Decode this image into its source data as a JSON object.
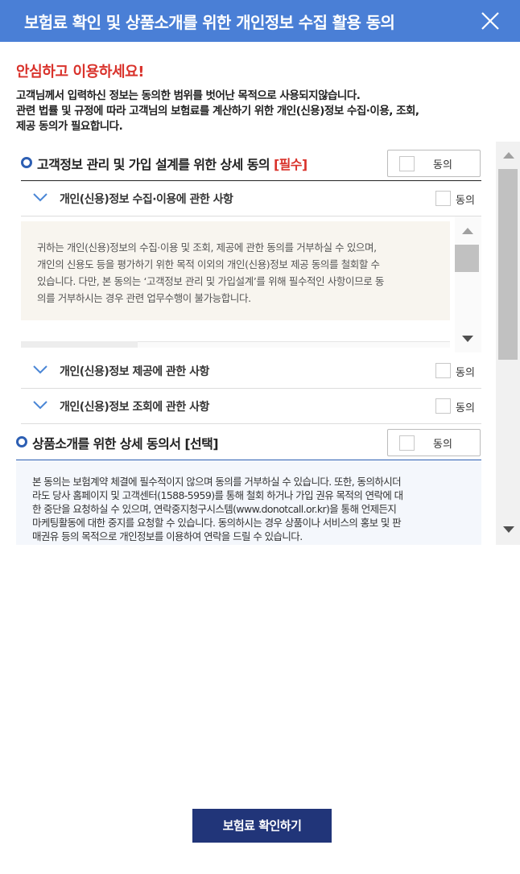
{
  "dialog": {
    "title": "보험료 확인 및 상품소개를 위한 개인정보 수집 활용 동의",
    "close_icon": "close-icon"
  },
  "intro": {
    "headline": "안심하고 이용하세요!",
    "lines": [
      "고객님께서 입력하신 정보는 동의한 범위를 벗어난 목적으로 사용되지않습니다.",
      "관련 법률 및 규정에 따라 고객님의 보험료를 계산하기 위한 개인(신용)정보 수집·이용, 조회,",
      "제공 동의가 필요합니다."
    ]
  },
  "section1": {
    "title": "고객정보 관리 및 가입 설계를 위한 상세 동의",
    "required_tag": "[필수]",
    "agree_label": "동의",
    "items": [
      {
        "title": "개인(신용)정보 수집·이용에 관한 사항",
        "agree_label": "동의",
        "expanded": true
      },
      {
        "title": "개인(신용)정보 제공에 관한 사항",
        "agree_label": "동의",
        "expanded": false
      },
      {
        "title": "개인(신용)정보 조회에 관한 사항",
        "agree_label": "동의",
        "expanded": false
      }
    ],
    "detail_lines": [
      "귀하는 개인(신용)정보의 수집·이용 및 조회, 제공에 관한 동의를 거부하실 수 있으며,",
      "개인의 신용도 등을 평가하기 위한 목적 이외의 개인(신용)정보 제공 동의를 철회할 수",
      "있습니다. 다만, 본 동의는 ‘고객정보 관리 및 가입설계’를 위해 필수적인 사항이므로 동",
      "의를 거부하시는 경우 관련 업무수행이 불가능합니다."
    ]
  },
  "section2": {
    "title": "상품소개를 위한 상세 동의서 [선택]",
    "agree_label": "동의",
    "lines": [
      "본 동의는 보험계약 체결에 필수적이지 않으며 동의를 거부하실 수 있습니다. 또한, 동의하시더",
      "라도 당사 홈페이지 및 고객센터(1588-5959)를 통해 철회 하거나 가입 권유 목적의 연락에 대",
      "한 중단을 요청하실 수 있으며, 연락중지청구시스템(www.donotcall.or.kr)을 통해 언제든지",
      "마케팅활동에 대한 중지를 요청할 수 있습니다. 동의하시는 경우 상품이나 서비스의 홍보 및 판",
      "매권유 등의 목적으로 개인정보를 이용하여 연락을 드릴 수 있습니다."
    ]
  },
  "footer": {
    "confirm_label": "보험료 확인하기"
  },
  "colors": {
    "header_bg": "#4a7fd6",
    "headline_red": "#d9322b",
    "button_navy": "#213579",
    "radio_blue": "#2d5fb3"
  }
}
